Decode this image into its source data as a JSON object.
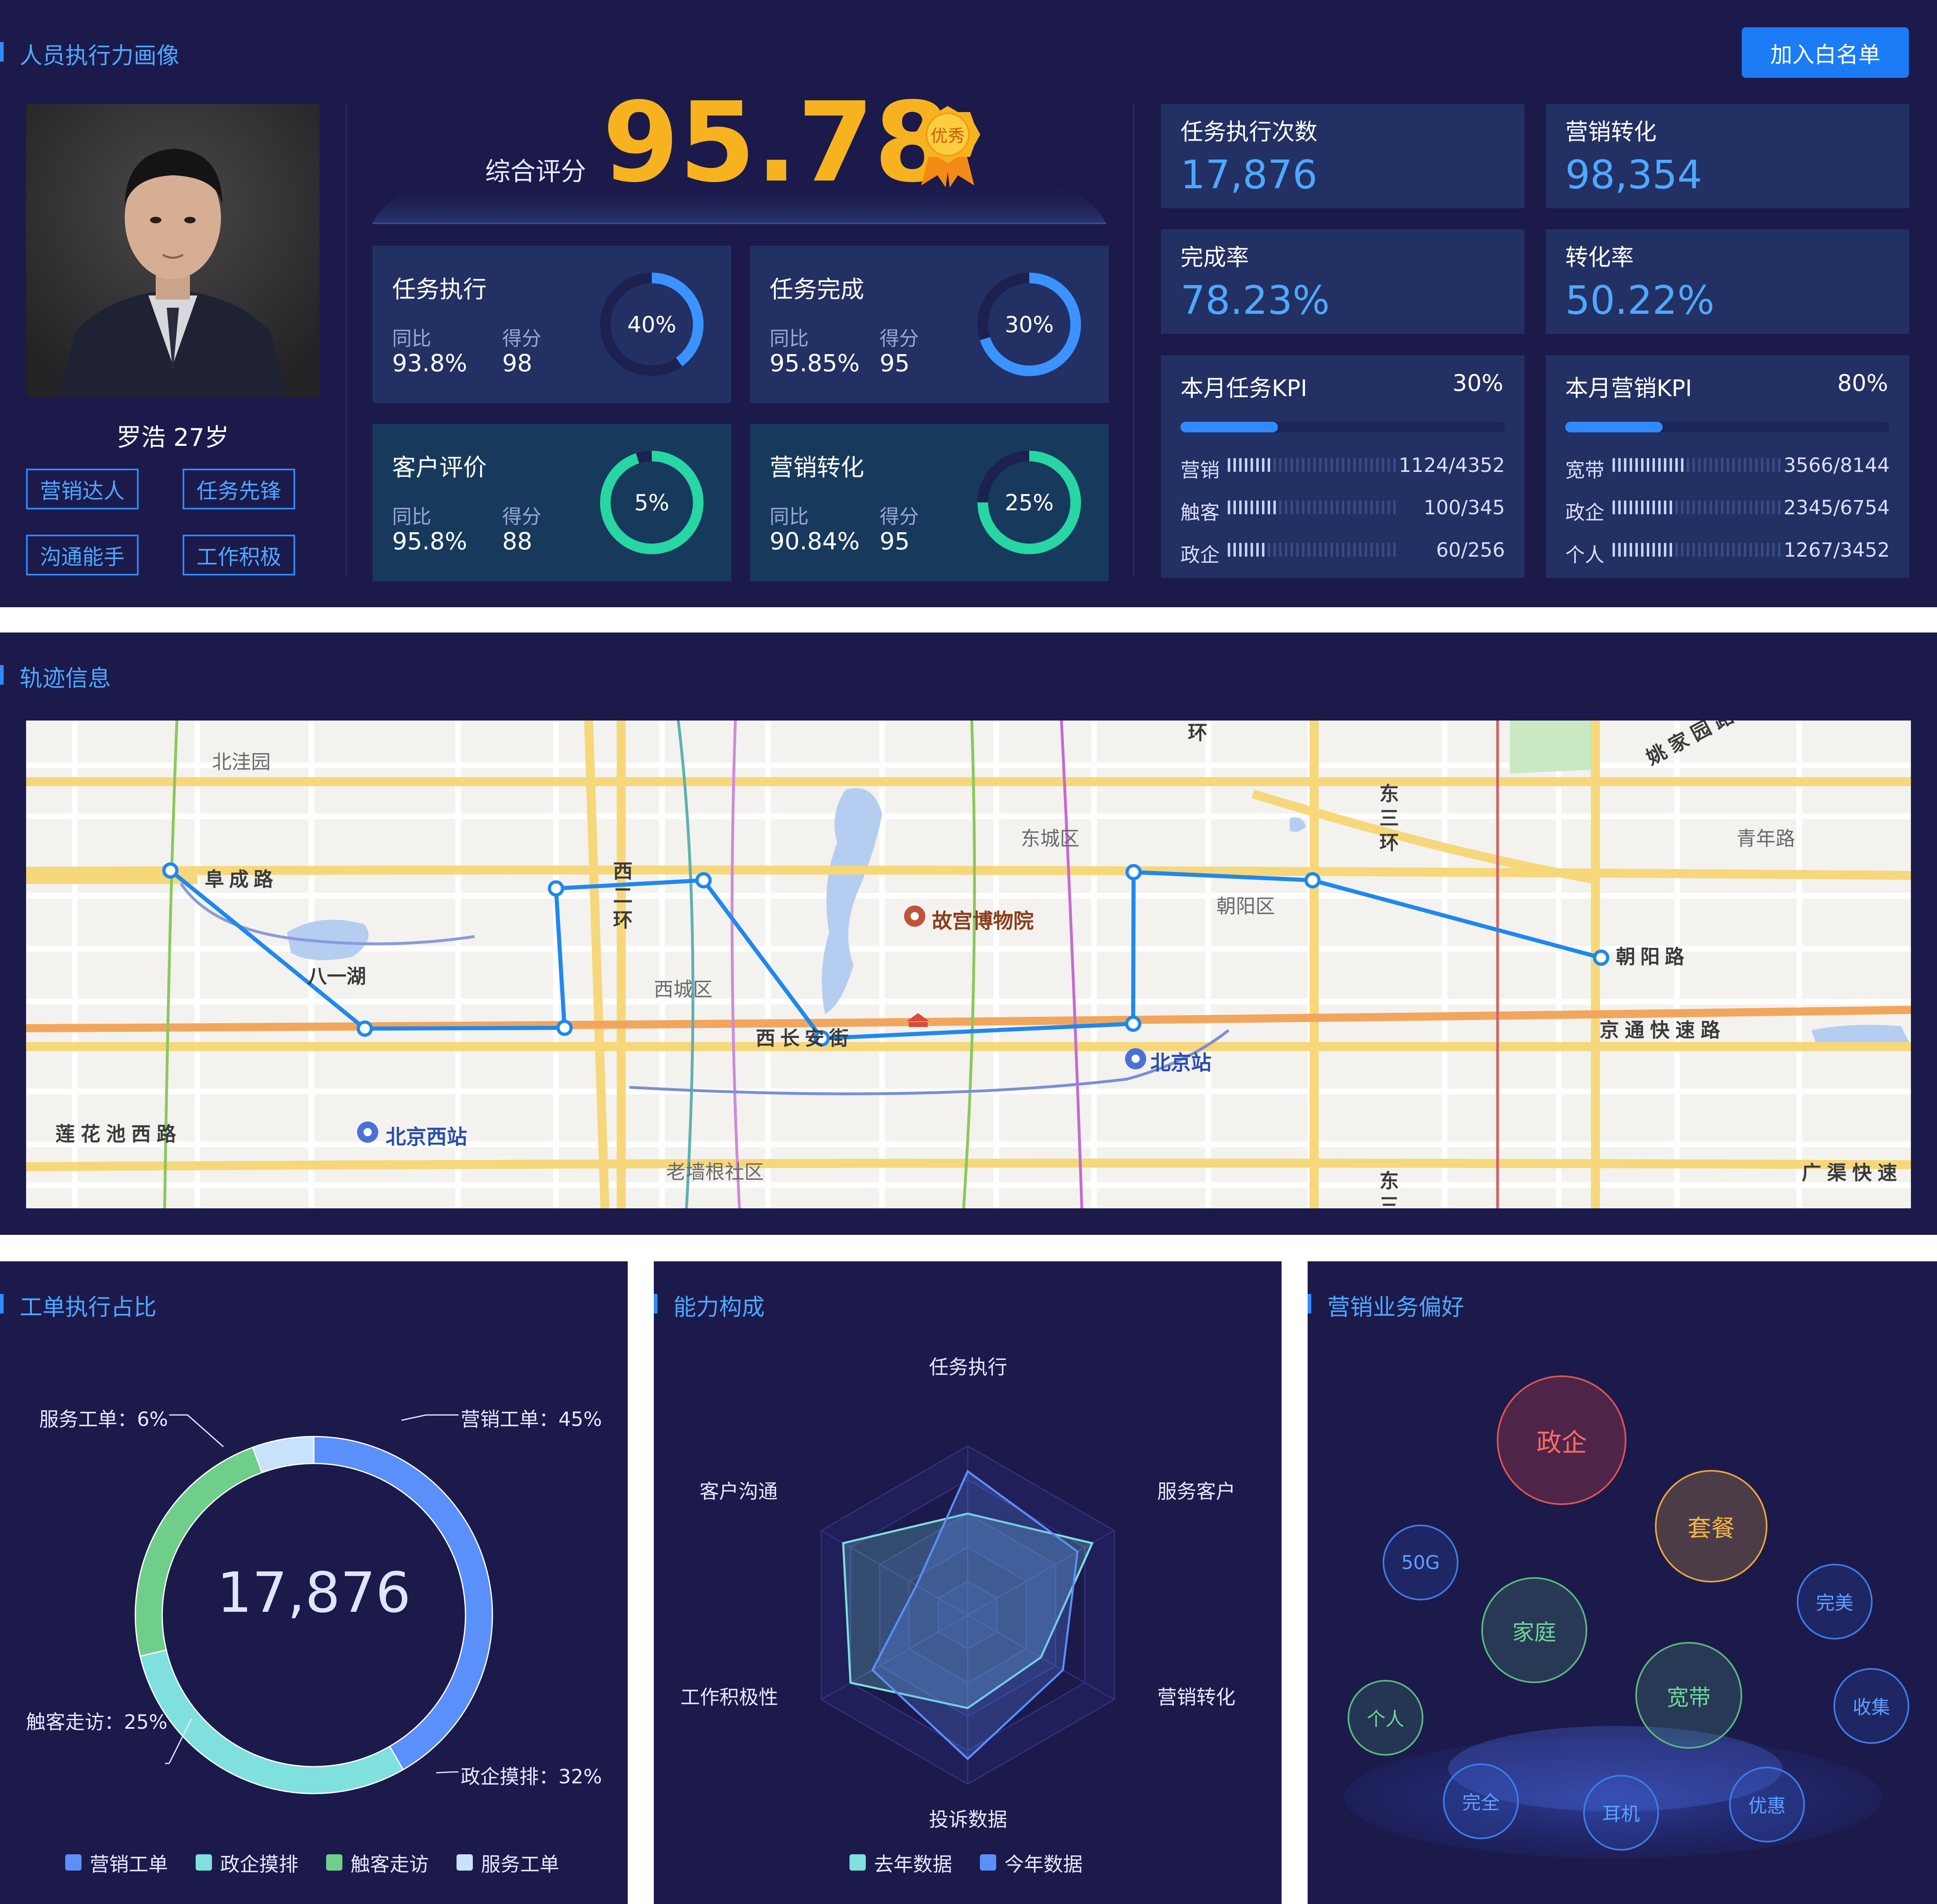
{
  "profile_panel": {
    "title": "人员执行力画像",
    "whitelist_button": "加入白名单",
    "person": {
      "name_age": "罗浩 27岁"
    },
    "tags": [
      "营销达人",
      "任务先锋",
      "沟通能手",
      "工作积极"
    ],
    "score": {
      "label": "综合评分",
      "value": "95.78",
      "badge": "优秀"
    },
    "metric_cards": [
      {
        "title": "任务执行",
        "l1": "同比",
        "l2": "得分",
        "v1": "93.8%",
        "v2": "98",
        "ring": "40%",
        "ring_value": 0.4,
        "color": "#3b93ff"
      },
      {
        "title": "任务完成",
        "l1": "同比",
        "l2": "得分",
        "v1": "95.85%",
        "v2": "95",
        "ring": "30%",
        "ring_value": 0.7,
        "color": "#3b93ff"
      },
      {
        "title": "客户评价",
        "l1": "同比",
        "l2": "得分",
        "v1": "95.8%",
        "v2": "88",
        "ring": "5%",
        "ring_value": 0.95,
        "color": "#27d6a3"
      },
      {
        "title": "营销转化",
        "l1": "同比",
        "l2": "得分",
        "v1": "90.84%",
        "v2": "95",
        "ring": "25%",
        "ring_value": 0.75,
        "color": "#27d6a3"
      }
    ],
    "stats": [
      {
        "label": "任务执行次数",
        "value": "17,876"
      },
      {
        "label": "营销转化",
        "value": "98,354"
      },
      {
        "label": "完成率",
        "value": "78.23%"
      },
      {
        "label": "转化率",
        "value": "50.22%"
      }
    ],
    "kpis": [
      {
        "title": "本月任务KPI",
        "pct": "30%",
        "fill": 0.3,
        "rows": [
          {
            "label": "营销",
            "value": "1124/4352",
            "ratio": 0.26
          },
          {
            "label": "触客",
            "value": "100/345",
            "ratio": 0.29
          },
          {
            "label": "政企",
            "value": "60/256",
            "ratio": 0.23
          }
        ]
      },
      {
        "title": "本月营销KPI",
        "pct": "80%",
        "fill": 0.3,
        "rows": [
          {
            "label": "宽带",
            "value": "3566/8144",
            "ratio": 0.44
          },
          {
            "label": "政企",
            "value": "2345/6754",
            "ratio": 0.35
          },
          {
            "label": "个人",
            "value": "1267/3452",
            "ratio": 0.37
          }
        ]
      }
    ]
  },
  "trajectory_panel": {
    "title": "轨迹信息",
    "map_labels": [
      "北洼园",
      "阜成路",
      "八一湖",
      "西二环",
      "西城区",
      "西长安街",
      "东城区",
      "故宫博物院",
      "北京站",
      "朝阳区",
      "东三环",
      "朝阳路",
      "京通快速路",
      "青年路",
      "姚家园路",
      "莲花池西路",
      "北京西站",
      "老墙根社区",
      "广渠快速",
      "东三",
      "环"
    ]
  },
  "work_order_panel": {
    "title": "工单执行占比",
    "center_value": "17,876",
    "labels": [
      "营销工单：45%",
      "政企摸排：32%",
      "触客走访：25%",
      "服务工单：6%"
    ],
    "legend": [
      "营销工单",
      "政企摸排",
      "触客走访",
      "服务工单"
    ],
    "chart_data": {
      "type": "pie",
      "categories": [
        "营销工单",
        "政企摸排",
        "触客走访",
        "服务工单"
      ],
      "values": [
        45,
        32,
        25,
        6
      ],
      "colors": [
        "#5b8ff9",
        "#7fe0de",
        "#6fcf8a",
        "#c9e2fb"
      ]
    }
  },
  "ability_panel": {
    "title": "能力构成",
    "axes": [
      "任务执行",
      "服务客户",
      "营销转化",
      "投诉数据",
      "工作积极性",
      "客户沟通"
    ],
    "legend": [
      "去年数据",
      "今年数据"
    ],
    "chart_data": {
      "type": "radar",
      "axes": [
        "任务执行",
        "服务客户",
        "营销转化",
        "投诉数据",
        "工作积极性",
        "客户沟通"
      ],
      "max": 100,
      "series": [
        {
          "name": "去年数据",
          "values": [
            60,
            85,
            50,
            55,
            80,
            85
          ],
          "color": "#7fe0de"
        },
        {
          "name": "今年数据",
          "values": [
            85,
            75,
            65,
            85,
            65,
            35
          ],
          "color": "#5b8ff9"
        }
      ]
    }
  },
  "preference_panel": {
    "title": "营销业务偏好",
    "bubbles": [
      "政企",
      "套餐",
      "50G",
      "家庭",
      "完美",
      "宽带",
      "个人",
      "收集",
      "完全",
      "耳机",
      "优惠"
    ]
  }
}
